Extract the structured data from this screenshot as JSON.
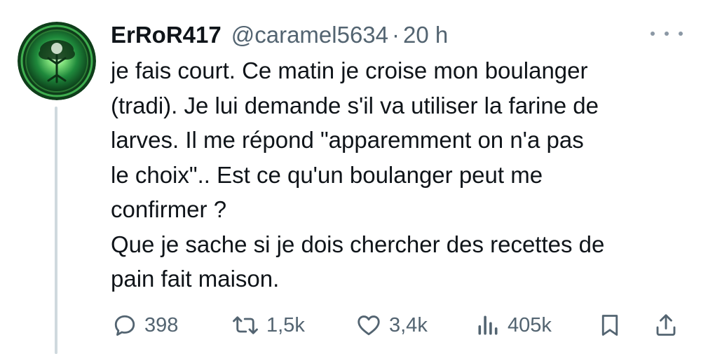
{
  "tweet": {
    "author": {
      "display_name": "ErRoR417",
      "handle": "@caramel5634",
      "avatar_icon": "tree-of-life-avatar"
    },
    "separator": "·",
    "time": "20 h",
    "text_lines": [
      "je fais court. Ce matin je croise mon boulanger",
      "(tradi). Je lui demande s'il va utiliser la farine de",
      "larves. Il me répond \"apparemment on n'a pas",
      "le choix\".. Est ce qu'un boulanger peut me",
      "confirmer ?",
      "Que je sache si je dois chercher des recettes de",
      "pain fait maison."
    ],
    "actions": {
      "replies": {
        "icon": "reply-icon",
        "count": "398"
      },
      "reposts": {
        "icon": "repost-icon",
        "count": "1,5k"
      },
      "likes": {
        "icon": "heart-icon",
        "count": "3,4k"
      },
      "views": {
        "icon": "views-icon",
        "count": "405k"
      },
      "bookmark": {
        "icon": "bookmark-icon"
      },
      "share": {
        "icon": "share-icon"
      }
    }
  },
  "colors": {
    "text": "#0f1419",
    "secondary": "#536471",
    "thread_line": "#cfd9de",
    "avatar_green": "#1f8a3c"
  }
}
